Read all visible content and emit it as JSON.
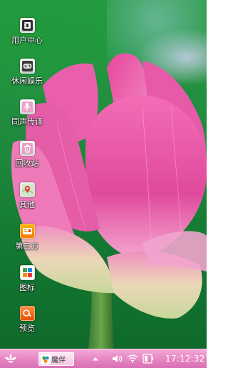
{
  "desktop": {
    "icons": [
      {
        "label": "用户中心",
        "icon": "user-center-icon"
      },
      {
        "label": "休闲娱乐",
        "icon": "gamepad-icon"
      },
      {
        "label": "同声传译",
        "icon": "microphone-icon"
      },
      {
        "label": "回收站",
        "icon": "recycle-bin-icon"
      },
      {
        "label": "其他",
        "icon": "map-pin-icon"
      },
      {
        "label": "第三方",
        "icon": "third-party-app-icon"
      },
      {
        "label": "图标",
        "icon": "icons-app-icon"
      },
      {
        "label": "预览",
        "icon": "preview-app-icon"
      }
    ]
  },
  "taskbar": {
    "start_icon": "lotus-flower-icon",
    "task_item_label": "魔伴",
    "task_item_icon": "mobanban-app-icon",
    "tray_icons": [
      "chevron-up-icon",
      "speaker-icon",
      "wifi-icon",
      "battery-icon"
    ],
    "clock": "17:12:32"
  },
  "colors": {
    "taskbar_pink": "#e887c4",
    "lotus_pink": "#e0489a",
    "leaf_green": "#1f8a3d"
  }
}
